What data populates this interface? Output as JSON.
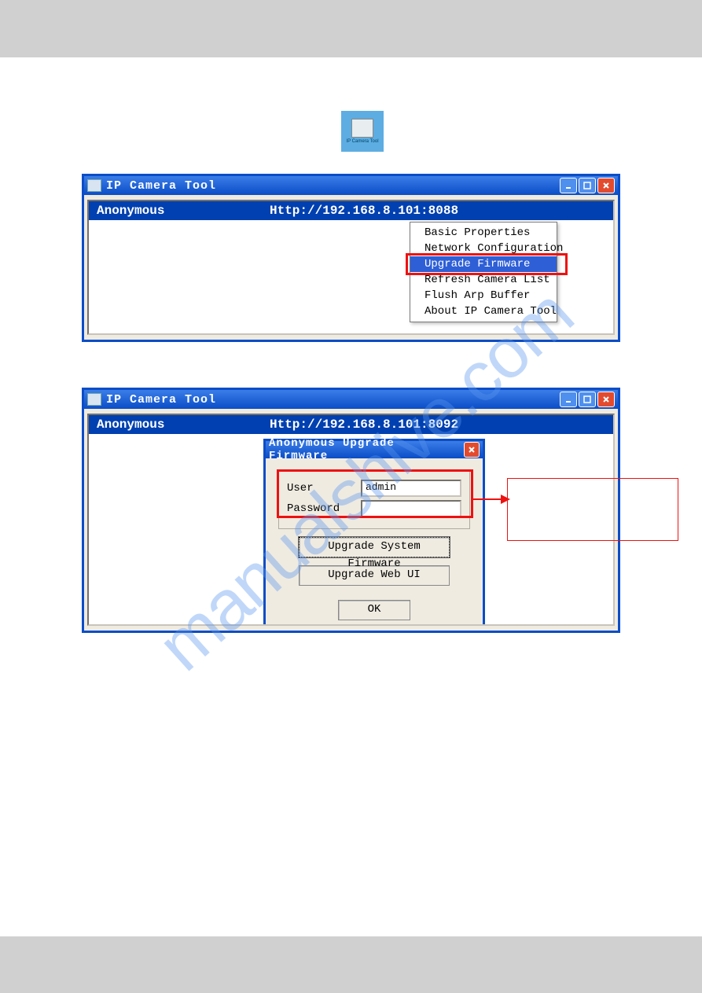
{
  "desktop_icon": {
    "label": "IP Camera Tool"
  },
  "window1": {
    "title": "IP Camera Tool",
    "camera_name": "Anonymous",
    "camera_url": "Http://192.168.8.101:8088",
    "context_menu": {
      "items": {
        "0": {
          "label": "Basic Properties"
        },
        "1": {
          "label": "Network Configuration"
        },
        "2": {
          "label": "Upgrade Firmware"
        },
        "3": {
          "label": "Refresh Camera List"
        },
        "4": {
          "label": "Flush Arp Buffer"
        },
        "5": {
          "label": "About IP Camera Tool"
        }
      }
    }
  },
  "window2": {
    "title": "IP Camera Tool",
    "camera_name": "Anonymous",
    "camera_url": "Http://192.168.8.101:8092",
    "dialog": {
      "title": "Anonymous Upgrade Firmware",
      "user_label": "User",
      "user_value": "admin",
      "password_label": "Password",
      "password_value": "",
      "btn_system": "Upgrade System Firmware",
      "btn_webui": "Upgrade Web UI",
      "btn_ok": "OK"
    }
  },
  "watermark": "manualshive.com"
}
